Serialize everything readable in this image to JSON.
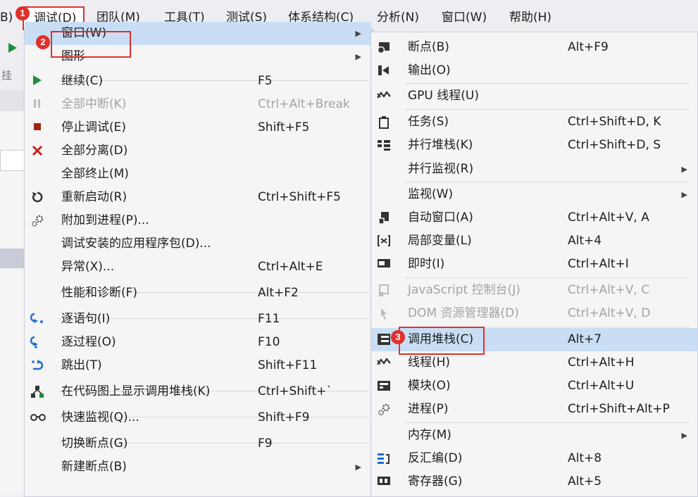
{
  "menubar": {
    "items": [
      "B)",
      "调试(D)",
      "团队(M)",
      "工具(T)",
      "测试(S)",
      "体系结构(C)",
      "分析(N)",
      "窗口(W)",
      "帮助(H)"
    ]
  },
  "badges": [
    "1",
    "2",
    "3"
  ],
  "bg_labels": {
    "attach": "挂"
  },
  "debug_menu": [
    {
      "label": "窗口(W)",
      "shortcut": "",
      "submenu": true,
      "icon": "none",
      "highlighted": true
    },
    {
      "label": "图形",
      "shortcut": "",
      "submenu": true,
      "icon": "none"
    },
    {
      "label": "继续(C)",
      "shortcut": "F5",
      "icon": "play-icon"
    },
    {
      "label": "全部中断(K)",
      "shortcut": "Ctrl+Alt+Break",
      "icon": "pause-icon",
      "disabled": true
    },
    {
      "label": "停止调试(E)",
      "shortcut": "Shift+F5",
      "icon": "stop-icon"
    },
    {
      "label": "全部分离(D)",
      "shortcut": "",
      "icon": "x-icon"
    },
    {
      "label": "全部终止(M)",
      "shortcut": "",
      "icon": "none"
    },
    {
      "label": "重新启动(R)",
      "shortcut": "Ctrl+Shift+F5",
      "icon": "restart-icon"
    },
    {
      "label": "附加到进程(P)...",
      "shortcut": "",
      "icon": "gears-icon"
    },
    {
      "label": "调试安装的应用程序包(D)...",
      "shortcut": "",
      "icon": "none"
    },
    {
      "label": "异常(X)...",
      "shortcut": "Ctrl+Alt+E",
      "icon": "none"
    },
    {
      "label": "性能和诊断(F)",
      "shortcut": "Alt+F2",
      "icon": "none"
    },
    {
      "label": "逐语句(I)",
      "shortcut": "F11",
      "icon": "step-into-icon"
    },
    {
      "label": "逐过程(O)",
      "shortcut": "F10",
      "icon": "step-over-icon"
    },
    {
      "label": "跳出(T)",
      "shortcut": "Shift+F11",
      "icon": "step-out-icon"
    },
    {
      "label": "在代码图上显示调用堆栈(K)",
      "shortcut": "Ctrl+Shift+`",
      "icon": "code-map-icon"
    },
    {
      "label": "快速监视(Q)...",
      "shortcut": "Shift+F9",
      "icon": "glasses-icon"
    },
    {
      "label": "切换断点(G)",
      "shortcut": "F9",
      "icon": "none"
    },
    {
      "label": "新建断点(B)",
      "shortcut": "",
      "submenu": true,
      "icon": "none"
    }
  ],
  "window_menu": [
    {
      "label": "断点(B)",
      "shortcut": "Alt+F9",
      "icon": "breakpoint-window-icon"
    },
    {
      "label": "输出(O)",
      "shortcut": "",
      "icon": "output-icon"
    },
    {
      "label": "GPU 线程(U)",
      "shortcut": "",
      "icon": "gpu-threads-icon"
    },
    {
      "label": "任务(S)",
      "shortcut": "Ctrl+Shift+D, K",
      "icon": "tasks-icon"
    },
    {
      "label": "并行堆栈(K)",
      "shortcut": "Ctrl+Shift+D, S",
      "icon": "parallel-stacks-icon"
    },
    {
      "label": "并行监视(R)",
      "shortcut": "",
      "submenu": true,
      "icon": "none"
    },
    {
      "label": "监视(W)",
      "shortcut": "",
      "submenu": true,
      "icon": "none"
    },
    {
      "label": "自动窗口(A)",
      "shortcut": "Ctrl+Alt+V, A",
      "icon": "autos-icon"
    },
    {
      "label": "局部变量(L)",
      "shortcut": "Alt+4",
      "icon": "locals-icon"
    },
    {
      "label": "即时(I)",
      "shortcut": "Ctrl+Alt+I",
      "icon": "immediate-icon"
    },
    {
      "label": "JavaScript 控制台(J)",
      "shortcut": "Ctrl+Alt+V, C",
      "icon": "js-console-icon",
      "disabled": true
    },
    {
      "label": "DOM 资源管理器(D)",
      "shortcut": "Ctrl+Alt+V, D",
      "icon": "dom-explorer-icon",
      "disabled": true
    },
    {
      "label": "调用堆栈(C)",
      "shortcut": "Alt+7",
      "icon": "call-stack-icon",
      "highlighted": true
    },
    {
      "label": "线程(H)",
      "shortcut": "Ctrl+Alt+H",
      "icon": "threads-icon"
    },
    {
      "label": "模块(O)",
      "shortcut": "Ctrl+Alt+U",
      "icon": "modules-icon"
    },
    {
      "label": "进程(P)",
      "shortcut": "Ctrl+Shift+Alt+P",
      "icon": "processes-icon"
    },
    {
      "label": "内存(M)",
      "shortcut": "",
      "submenu": true,
      "icon": "none"
    },
    {
      "label": "反汇编(D)",
      "shortcut": "Alt+8",
      "icon": "disassembly-icon"
    },
    {
      "label": "寄存器(G)",
      "shortcut": "Alt+5",
      "icon": "registers-icon"
    }
  ],
  "colors": {
    "highlight": "#c9def5",
    "accent_red": "#e0302a",
    "menu_bg": "#f5f5f5"
  }
}
